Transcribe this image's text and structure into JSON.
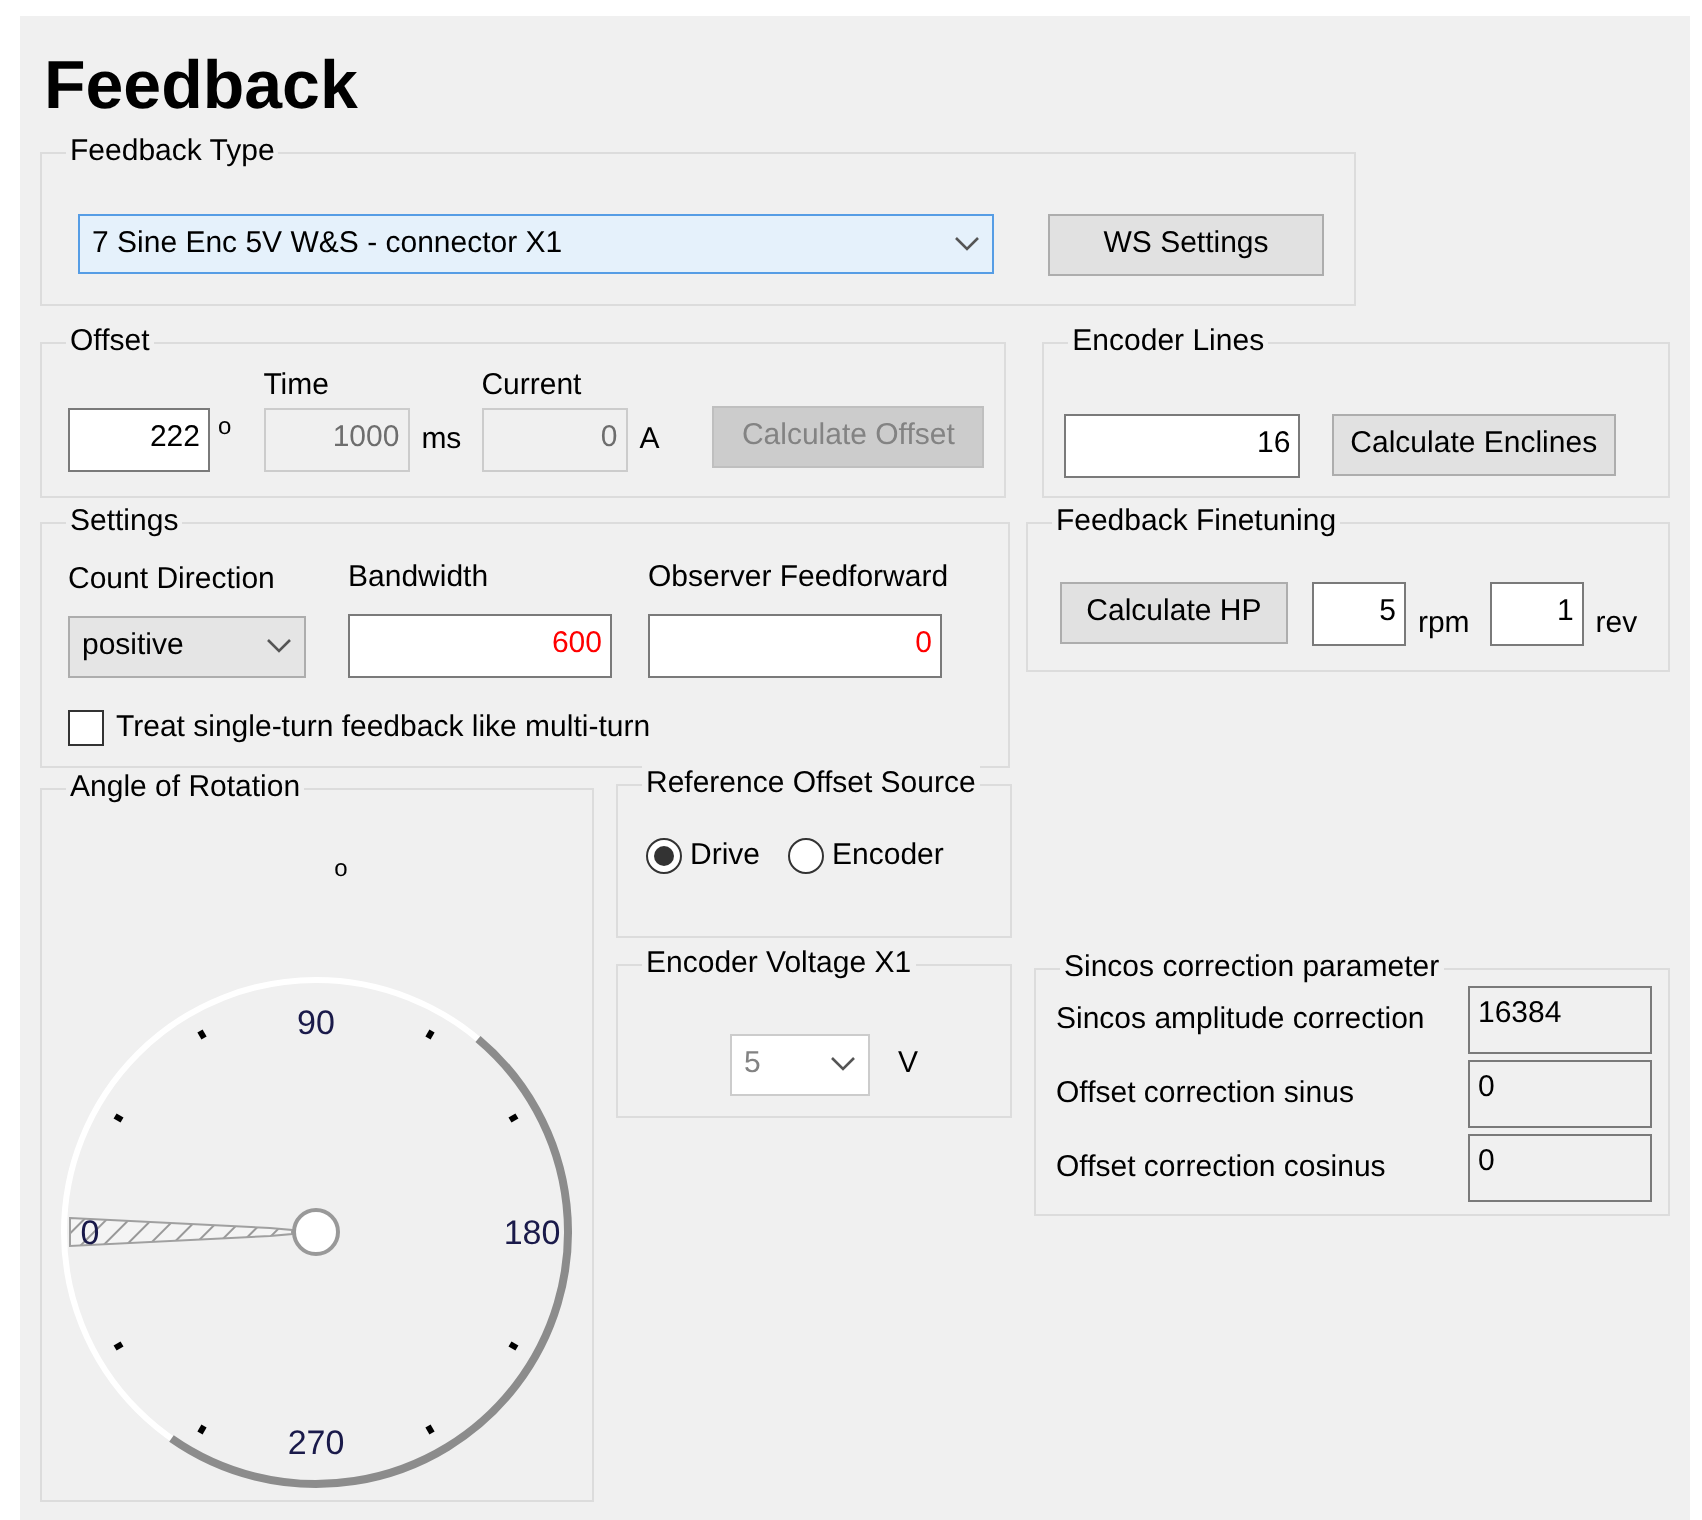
{
  "title": "Feedback",
  "feedback_type": {
    "label": "Feedback Type",
    "value": "7 Sine Enc 5V W&S - connector X1",
    "button": "WS Settings"
  },
  "offset": {
    "label": "Offset",
    "value": "222",
    "unit": "o",
    "button": "Calculate Offset",
    "button_disabled": true,
    "fields": [
      {
        "label": "Time",
        "value": "1000",
        "unit": "ms",
        "disabled": true
      },
      {
        "label": "Current",
        "value": "0",
        "unit": "A",
        "disabled": true
      }
    ]
  },
  "encoder_lines": {
    "label": "Encoder Lines",
    "value": "16",
    "button": "Calculate Enclines"
  },
  "settings": {
    "label": "Settings",
    "count_direction": {
      "label": "Count Direction",
      "value": "positive"
    },
    "fields": [
      {
        "label": "Bandwidth",
        "value": "600",
        "changed": true
      },
      {
        "label": "Observer Feedforward",
        "value": "0",
        "changed": true
      }
    ],
    "checkbox": {
      "label": "Treat single-turn feedback like multi-turn",
      "checked": false
    }
  },
  "finetuning": {
    "label": "Feedback Finetuning",
    "button": "Calculate HP",
    "fields": [
      {
        "value": "5",
        "unit": "rpm"
      },
      {
        "value": "1",
        "unit": "rev"
      }
    ]
  },
  "angle_of_rotation": {
    "label": "Angle of Rotation",
    "reading": "o",
    "dial_labels": [
      "0",
      "90",
      "180",
      "270"
    ]
  },
  "reference_offset_source": {
    "label": "Reference Offset Source",
    "options": [
      {
        "label": "Drive",
        "selected": true
      },
      {
        "label": "Encoder",
        "selected": false
      }
    ]
  },
  "encoder_voltage": {
    "label": "Encoder Voltage X1",
    "value": "5",
    "unit": "V",
    "disabled": true
  },
  "sincos": {
    "label": "Sincos correction parameter",
    "rows": [
      {
        "label": "Sincos amplitude correction",
        "value": "16384"
      },
      {
        "label": "Offset correction sinus",
        "value": "0"
      },
      {
        "label": "Offset correction cosinus",
        "value": "0"
      }
    ]
  }
}
